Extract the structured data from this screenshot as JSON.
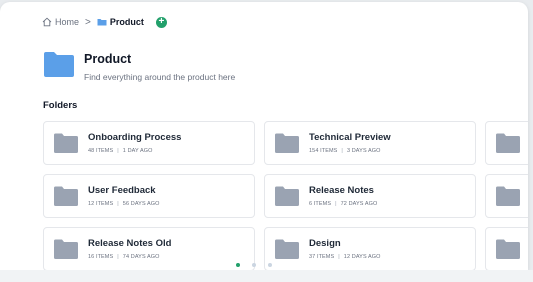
{
  "breadcrumb": {
    "home_label": "Home",
    "current_label": "Product",
    "add_symbol": "+"
  },
  "header": {
    "title": "Product",
    "subtitle": "Find everything around the product here"
  },
  "section": {
    "folders_label": "Folders"
  },
  "folders": [
    {
      "name": "Onboarding Process",
      "items": "48 ITEMS",
      "updated": "1 DAY AGO"
    },
    {
      "name": "Technical Preview",
      "items": "154 ITEMS",
      "updated": "3 DAYS AGO"
    },
    {
      "name": "",
      "items": "",
      "updated": ""
    },
    {
      "name": "User Feedback",
      "items": "12 ITEMS",
      "updated": "56 DAYS AGO"
    },
    {
      "name": "Release Notes",
      "items": "6 ITEMS",
      "updated": "72 DAYS AGO"
    },
    {
      "name": "",
      "items": "",
      "updated": ""
    },
    {
      "name": "Release Notes Old",
      "items": "16 ITEMS",
      "updated": "74 DAYS AGO"
    },
    {
      "name": "Design",
      "items": "37 ITEMS",
      "updated": "12 DAYS AGO"
    },
    {
      "name": "",
      "items": "",
      "updated": ""
    }
  ],
  "pager": {
    "pages": 3,
    "active_page": 1
  },
  "colors": {
    "accent": "#22a06b",
    "folder_grey": "#9aa3b2",
    "folder_blue": "#5b9fe8"
  },
  "icons": {
    "home": "home-icon",
    "breadcrumb_folder": "folder-icon",
    "add": "plus-icon",
    "folder": "folder-icon"
  }
}
